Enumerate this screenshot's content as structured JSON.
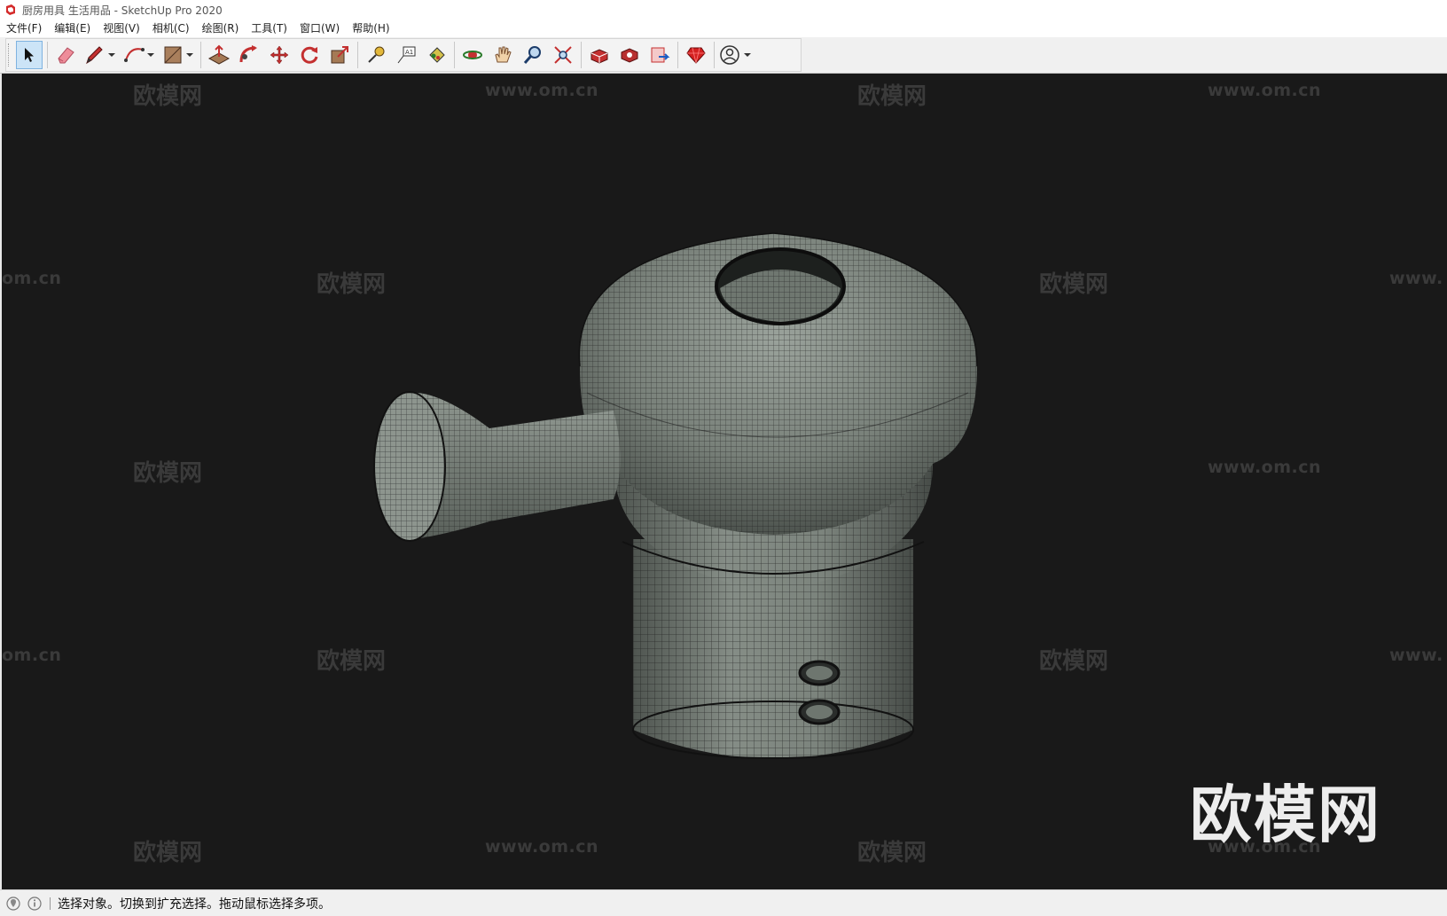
{
  "window": {
    "title": "厨房用具 生活用品 - SketchUp Pro 2020"
  },
  "menu": [
    {
      "label": "文件(F)"
    },
    {
      "label": "编辑(E)"
    },
    {
      "label": "视图(V)"
    },
    {
      "label": "相机(C)"
    },
    {
      "label": "绘图(R)"
    },
    {
      "label": "工具(T)"
    },
    {
      "label": "窗口(W)"
    },
    {
      "label": "帮助(H)"
    }
  ],
  "toolbar": {
    "tools": [
      "select-icon",
      "eraser-icon",
      "pencil-icon",
      "arc-icon",
      "shape-icon",
      "push-pull-icon",
      "follow-me-icon",
      "move-icon",
      "rotate-icon",
      "scale-icon",
      "tape-measure-icon",
      "text-icon",
      "paint-bucket-icon",
      "orbit-icon",
      "pan-icon",
      "zoom-icon",
      "zoom-extents-icon",
      "warehouse-icon",
      "extension-warehouse-icon",
      "layout-icon",
      "ruby-icon",
      "account-icon"
    ]
  },
  "watermarks": {
    "brand": "欧模网",
    "url": "www.om.cn",
    "url_partial_left": "om.cn",
    "url_partial_right": "www.",
    "large": "欧模网"
  },
  "status": {
    "message": "选择对象。切换到扩充选择。拖动鼠标选择多项。"
  },
  "colors": {
    "viewport_bg": "#191919",
    "accent": "#cce4f7",
    "model_stone": "#7b827c"
  }
}
